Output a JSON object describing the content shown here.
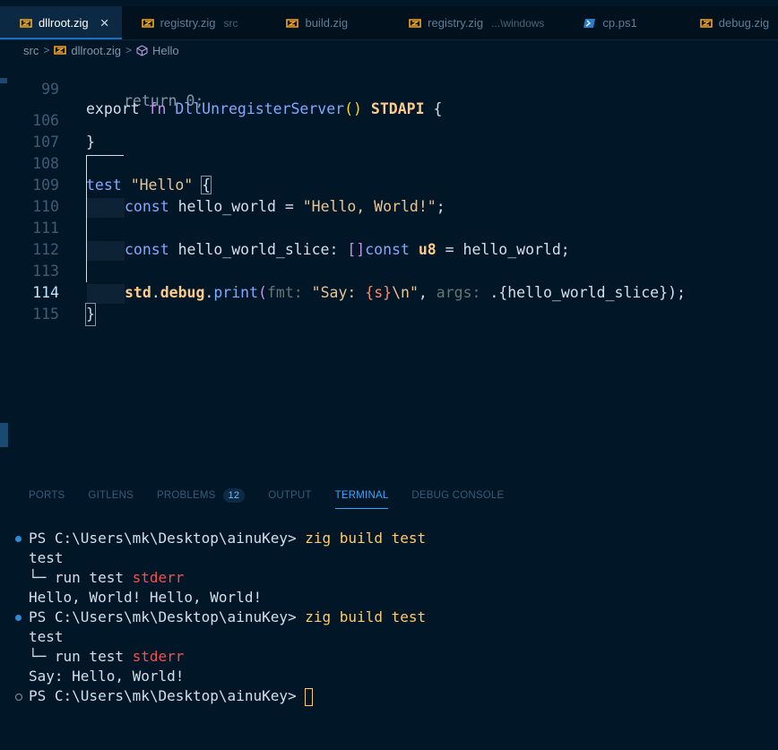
{
  "tabs": [
    {
      "label": "dllroot.zig",
      "sub": "",
      "icon": "zig-icon",
      "active": true,
      "close": "×"
    },
    {
      "label": "registry.zig",
      "sub": "src",
      "icon": "zig-icon",
      "active": false
    },
    {
      "label": "build.zig",
      "sub": "",
      "icon": "zig-icon",
      "active": false
    },
    {
      "label": "registry.zig",
      "sub": "...\\windows",
      "icon": "zig-icon",
      "active": false
    },
    {
      "label": "cp.ps1",
      "sub": "",
      "icon": "powershell-icon",
      "active": false
    },
    {
      "label": "debug.zig",
      "sub": "",
      "icon": "zig-icon",
      "active": false
    }
  ],
  "breadcrumb": {
    "folder": "src",
    "file": "dllroot.zig",
    "symbol": "Hello",
    "sep": ">"
  },
  "editor": {
    "sticky_line": {
      "num": "99",
      "text_export": "export",
      "text_fn": "fn",
      "text_name": "DllUnregisterServer",
      "text_parens": "()",
      "text_type": "STDAPI",
      "text_brace": "{"
    },
    "hidden_text": "return 0;",
    "lines": [
      {
        "num": "106",
        "text": "}"
      },
      {
        "num": "107",
        "text": ""
      },
      {
        "num": "108",
        "kw": "test",
        "str": "\"Hello\"",
        "brace": "{"
      },
      {
        "num": "109",
        "kw": "const",
        "name": "hello_world",
        "eq": "=",
        "str": "\"Hello, World!\"",
        "end": ";"
      },
      {
        "num": "110",
        "text": ""
      },
      {
        "num": "111",
        "kw": "const",
        "name": "hello_world_slice:",
        "brackets": "[]",
        "kw2": "const",
        "type": "u8",
        "eq": "=",
        "val": "hello_world;"
      },
      {
        "num": "112",
        "text": ""
      },
      {
        "num": "113",
        "std": "std",
        "dot1": ".",
        "debug": "debug",
        "dot2": ".",
        "fn": "print",
        "open": "(",
        "hint1": "fmt:",
        "str1": "\"Say: ",
        "fmt": "{s}",
        "esc": "\\n",
        "str2": "\"",
        "comma": ",",
        "hint2": "args:",
        "args": ".{hello_world_slice}",
        "close": ");"
      },
      {
        "num": "114",
        "text": "}"
      },
      {
        "num": "115",
        "text": ""
      }
    ]
  },
  "panel": {
    "tabs": [
      "PORTS",
      "GITLENS",
      "PROBLEMS",
      "OUTPUT",
      "TERMINAL",
      "DEBUG CONSOLE"
    ],
    "problems_count": "12",
    "active_tab": "TERMINAL"
  },
  "terminal": {
    "prompt": "PS C:\\Users\\mk\\Desktop\\ainuKey>",
    "command": "zig build test",
    "lines": {
      "test1": "test",
      "tree1_prefix": "└─ run test",
      "tree1_err": "stderr",
      "out1": "Hello, World! Hello, World!",
      "test2": "test",
      "tree2_prefix": "└─ run test",
      "tree2_err": "stderr",
      "out2": "Say: Hello, World!"
    }
  },
  "colors": {
    "background": "#011627",
    "accent": "#3aa6ff",
    "command": "#ffcb6b",
    "error": "#ef5350"
  }
}
